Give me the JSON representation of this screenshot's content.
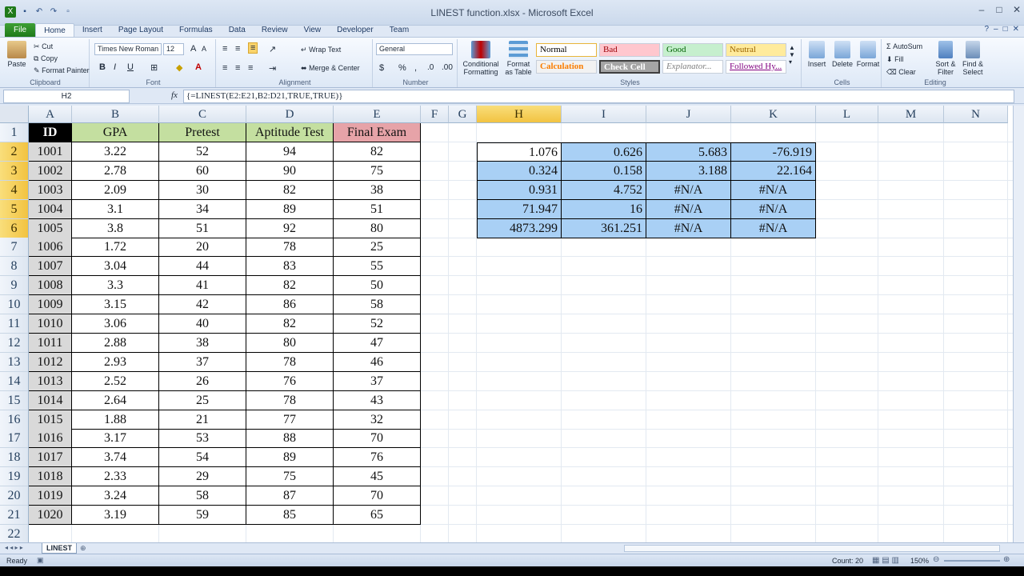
{
  "window": {
    "title": "LINEST function.xlsx - Microsoft Excel"
  },
  "ribbon_tabs": [
    "File",
    "Home",
    "Insert",
    "Page Layout",
    "Formulas",
    "Data",
    "Review",
    "View",
    "Developer",
    "Team"
  ],
  "ribbon": {
    "clipboard": {
      "paste": "Paste",
      "cut": "Cut",
      "copy": "Copy",
      "format_painter": "Format Painter",
      "label": "Clipboard"
    },
    "font": {
      "name": "Times New Roman",
      "size": "12",
      "bold": "B",
      "italic": "I",
      "underline": "U",
      "label": "Font"
    },
    "alignment": {
      "wrap": "Wrap Text",
      "merge": "Merge & Center",
      "label": "Alignment"
    },
    "number": {
      "format": "General",
      "currency": "$",
      "percent": "%",
      "comma": ",",
      "label": "Number"
    },
    "styles": {
      "conditional": "Conditional Formatting",
      "format_table": "Format as Table",
      "cells": [
        {
          "text": "Normal",
          "bg": "#ffffff",
          "fg": "#000000"
        },
        {
          "text": "Bad",
          "bg": "#ffc7ce",
          "fg": "#9c0006"
        },
        {
          "text": "Good",
          "bg": "#c6efce",
          "fg": "#006100"
        },
        {
          "text": "Neutral",
          "bg": "#ffeb9c",
          "fg": "#9c6500"
        },
        {
          "text": "Calculation",
          "bg": "#f2f2f2",
          "fg": "#fa7d00"
        },
        {
          "text": "Check Cell",
          "bg": "#a5a5a5",
          "fg": "#ffffff"
        },
        {
          "text": "Explanator...",
          "bg": "#ffffff",
          "fg": "#7f7f7f"
        },
        {
          "text": "Followed Hy...",
          "bg": "#ffffff",
          "fg": "#800080"
        }
      ],
      "label": "Styles"
    },
    "cells": {
      "insert": "Insert",
      "delete": "Delete",
      "format": "Format",
      "label": "Cells"
    },
    "editing": {
      "autosum": "AutoSum",
      "fill": "Fill",
      "clear": "Clear",
      "sort": "Sort & Filter",
      "find": "Find & Select",
      "label": "Editing"
    }
  },
  "formula_bar": {
    "name_box": "H2",
    "fx": "fx",
    "formula": "{=LINEST(E2:E21,B2:D21,TRUE,TRUE)}"
  },
  "columns": [
    "A",
    "B",
    "C",
    "D",
    "E",
    "F",
    "G",
    "H",
    "I",
    "J",
    "K",
    "L",
    "M",
    "N"
  ],
  "rows": [
    "1",
    "2",
    "3",
    "4",
    "5",
    "6",
    "7",
    "8",
    "9",
    "10",
    "11",
    "12",
    "13",
    "14",
    "15",
    "16",
    "17",
    "18",
    "19",
    "20",
    "21",
    "22"
  ],
  "headers": [
    "ID",
    "GPA",
    "Pretest",
    "Aptitude Test",
    "Final Exam"
  ],
  "header_colors": {
    "id_bg": "#000000",
    "id_fg": "#ffffff",
    "green": "#c4dfa0",
    "red": "#e6a3a8"
  },
  "data": [
    [
      "1001",
      "3.22",
      "52",
      "94",
      "82"
    ],
    [
      "1002",
      "2.78",
      "60",
      "90",
      "75"
    ],
    [
      "1003",
      "2.09",
      "30",
      "82",
      "38"
    ],
    [
      "1004",
      "3.1",
      "34",
      "89",
      "51"
    ],
    [
      "1005",
      "3.8",
      "51",
      "92",
      "80"
    ],
    [
      "1006",
      "1.72",
      "20",
      "78",
      "25"
    ],
    [
      "1007",
      "3.04",
      "44",
      "83",
      "55"
    ],
    [
      "1008",
      "3.3",
      "41",
      "82",
      "50"
    ],
    [
      "1009",
      "3.15",
      "42",
      "86",
      "58"
    ],
    [
      "1010",
      "3.06",
      "40",
      "82",
      "52"
    ],
    [
      "1011",
      "2.88",
      "38",
      "80",
      "47"
    ],
    [
      "1012",
      "2.93",
      "37",
      "78",
      "46"
    ],
    [
      "1013",
      "2.52",
      "26",
      "76",
      "37"
    ],
    [
      "1014",
      "2.64",
      "25",
      "78",
      "43"
    ],
    [
      "1015",
      "1.88",
      "21",
      "77",
      "32"
    ],
    [
      "1016",
      "3.17",
      "53",
      "88",
      "70"
    ],
    [
      "1017",
      "3.74",
      "54",
      "89",
      "76"
    ],
    [
      "1018",
      "2.33",
      "29",
      "75",
      "45"
    ],
    [
      "1019",
      "3.24",
      "58",
      "87",
      "70"
    ],
    [
      "1020",
      "3.19",
      "59",
      "85",
      "65"
    ]
  ],
  "linest": [
    [
      "1.076",
      "0.626",
      "5.683",
      "-76.919"
    ],
    [
      "0.324",
      "0.158",
      "3.188",
      "22.164"
    ],
    [
      "0.931",
      "4.752",
      "#N/A",
      "#N/A"
    ],
    [
      "71.947",
      "16",
      "#N/A",
      "#N/A"
    ],
    [
      "4873.299",
      "361.251",
      "#N/A",
      "#N/A"
    ]
  ],
  "sheet": {
    "tab": "LINEST"
  },
  "status": {
    "ready": "Ready",
    "count": "Count: 20",
    "zoom": "150%"
  }
}
